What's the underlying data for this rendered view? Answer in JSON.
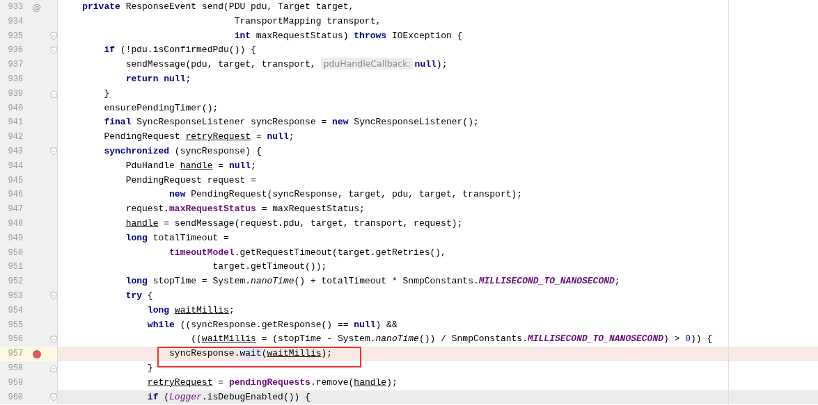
{
  "editor": {
    "lines": [
      {
        "number": "933",
        "gutter_mark": "@",
        "fold_open": false,
        "fold_close": false,
        "breakpoint": false,
        "current": false,
        "tokens": [
          {
            "kind": "keyword",
            "text": "    private"
          },
          {
            "kind": "plain",
            "text": " ResponseEvent send(PDU pdu, Target target,"
          }
        ]
      },
      {
        "number": "934",
        "fold_open": false,
        "fold_close": false,
        "breakpoint": false,
        "current": false,
        "tokens": [
          {
            "kind": "plain",
            "text": "                                TransportMapping transport,"
          }
        ]
      },
      {
        "number": "935",
        "fold_open": true,
        "fold_close": false,
        "breakpoint": false,
        "current": false,
        "tokens": [
          {
            "kind": "keyword",
            "text": "                                int"
          },
          {
            "kind": "plain",
            "text": " maxRequestStatus) "
          },
          {
            "kind": "keyword",
            "text": "throws"
          },
          {
            "kind": "plain",
            "text": " IOException {"
          }
        ]
      },
      {
        "number": "936",
        "fold_open": true,
        "fold_close": false,
        "breakpoint": false,
        "current": false,
        "tokens": [
          {
            "kind": "keyword",
            "text": "        if"
          },
          {
            "kind": "plain",
            "text": " (!pdu.isConfirmedPdu()) {"
          }
        ]
      },
      {
        "number": "937",
        "fold_open": false,
        "fold_close": false,
        "breakpoint": false,
        "current": false,
        "tokens": [
          {
            "kind": "plain",
            "text": "            sendMessage(pdu, target, transport, "
          },
          {
            "kind": "hint",
            "text": "pduHandleCallback:"
          },
          {
            "kind": "keyword",
            "text": "null"
          },
          {
            "kind": "plain",
            "text": ");"
          }
        ]
      },
      {
        "number": "938",
        "fold_open": false,
        "fold_close": false,
        "breakpoint": false,
        "current": false,
        "tokens": [
          {
            "kind": "keyword",
            "text": "            return null"
          },
          {
            "kind": "plain",
            "text": ";"
          }
        ]
      },
      {
        "number": "939",
        "fold_open": false,
        "fold_close": true,
        "breakpoint": false,
        "current": false,
        "tokens": [
          {
            "kind": "plain",
            "text": "        }"
          }
        ]
      },
      {
        "number": "940",
        "fold_open": false,
        "fold_close": false,
        "breakpoint": false,
        "current": false,
        "tokens": [
          {
            "kind": "plain",
            "text": "        ensurePendingTimer();"
          }
        ]
      },
      {
        "number": "941",
        "fold_open": false,
        "fold_close": false,
        "breakpoint": false,
        "current": false,
        "tokens": [
          {
            "kind": "keyword",
            "text": "        final"
          },
          {
            "kind": "plain",
            "text": " SyncResponseListener syncResponse = "
          },
          {
            "kind": "keyword",
            "text": "new"
          },
          {
            "kind": "plain",
            "text": " SyncResponseListener();"
          }
        ]
      },
      {
        "number": "942",
        "fold_open": false,
        "fold_close": false,
        "breakpoint": false,
        "current": false,
        "tokens": [
          {
            "kind": "plain",
            "text": "        PendingRequest "
          },
          {
            "kind": "reassigned",
            "text": "retryRequest"
          },
          {
            "kind": "plain",
            "text": " = "
          },
          {
            "kind": "keyword",
            "text": "null"
          },
          {
            "kind": "plain",
            "text": ";"
          }
        ]
      },
      {
        "number": "943",
        "fold_open": true,
        "fold_close": false,
        "breakpoint": false,
        "current": false,
        "tokens": [
          {
            "kind": "keyword",
            "text": "        synchronized"
          },
          {
            "kind": "plain",
            "text": " (syncResponse) {"
          }
        ]
      },
      {
        "number": "944",
        "fold_open": false,
        "fold_close": false,
        "breakpoint": false,
        "current": false,
        "tokens": [
          {
            "kind": "plain",
            "text": "            PduHandle "
          },
          {
            "kind": "reassigned",
            "text": "handle"
          },
          {
            "kind": "plain",
            "text": " = "
          },
          {
            "kind": "keyword",
            "text": "null"
          },
          {
            "kind": "plain",
            "text": ";"
          }
        ]
      },
      {
        "number": "945",
        "fold_open": false,
        "fold_close": false,
        "breakpoint": false,
        "current": false,
        "tokens": [
          {
            "kind": "plain",
            "text": "            PendingRequest request ="
          }
        ]
      },
      {
        "number": "946",
        "fold_open": false,
        "fold_close": false,
        "breakpoint": false,
        "current": false,
        "tokens": [
          {
            "kind": "keyword",
            "text": "                    new"
          },
          {
            "kind": "plain",
            "text": " PendingRequest(syncResponse, target, pdu, target, transport);"
          }
        ]
      },
      {
        "number": "947",
        "fold_open": false,
        "fold_close": false,
        "breakpoint": false,
        "current": false,
        "tokens": [
          {
            "kind": "plain",
            "text": "            request."
          },
          {
            "kind": "field",
            "text": "maxRequestStatus"
          },
          {
            "kind": "plain",
            "text": " = maxRequestStatus;"
          }
        ]
      },
      {
        "number": "948",
        "fold_open": false,
        "fold_close": false,
        "breakpoint": false,
        "current": false,
        "tokens": [
          {
            "kind": "reassigned",
            "text": "            handle"
          },
          {
            "kind": "plain",
            "text": " = sendMessage(request.pdu, target, transport, request);"
          }
        ]
      },
      {
        "number": "949",
        "fold_open": false,
        "fold_close": false,
        "breakpoint": false,
        "current": false,
        "tokens": [
          {
            "kind": "keyword",
            "text": "            long"
          },
          {
            "kind": "plain",
            "text": " totalTimeout ="
          }
        ]
      },
      {
        "number": "950",
        "fold_open": false,
        "fold_close": false,
        "breakpoint": false,
        "current": false,
        "tokens": [
          {
            "kind": "field",
            "text": "                    timeoutModel"
          },
          {
            "kind": "plain",
            "text": ".getRequestTimeout(target.getRetries(),"
          }
        ]
      },
      {
        "number": "951",
        "fold_open": false,
        "fold_close": false,
        "breakpoint": false,
        "current": false,
        "tokens": [
          {
            "kind": "plain",
            "text": "                            target.getTimeout());"
          }
        ]
      },
      {
        "number": "952",
        "fold_open": false,
        "fold_close": false,
        "breakpoint": false,
        "current": false,
        "tokens": [
          {
            "kind": "keyword",
            "text": "            long"
          },
          {
            "kind": "plain",
            "text": " stopTime = System."
          },
          {
            "kind": "static_method",
            "text": "nanoTime"
          },
          {
            "kind": "plain",
            "text": "() + totalTimeout * SnmpConstants."
          },
          {
            "kind": "constant",
            "text": "MILLISECOND_TO_NANOSECOND"
          },
          {
            "kind": "plain",
            "text": ";"
          }
        ]
      },
      {
        "number": "953",
        "fold_open": true,
        "fold_close": false,
        "breakpoint": false,
        "current": false,
        "tokens": [
          {
            "kind": "keyword",
            "text": "            try"
          },
          {
            "kind": "plain",
            "text": " {"
          }
        ]
      },
      {
        "number": "954",
        "fold_open": false,
        "fold_close": false,
        "breakpoint": false,
        "current": false,
        "tokens": [
          {
            "kind": "keyword",
            "text": "                long"
          },
          {
            "kind": "reassigned",
            "text": " waitMillis"
          },
          {
            "kind": "plain",
            "text": ";"
          }
        ]
      },
      {
        "number": "955",
        "fold_open": false,
        "fold_close": false,
        "breakpoint": false,
        "current": false,
        "tokens": [
          {
            "kind": "keyword",
            "text": "                while"
          },
          {
            "kind": "plain",
            "text": " ((syncResponse.getResponse() == "
          },
          {
            "kind": "keyword",
            "text": "null"
          },
          {
            "kind": "plain",
            "text": ") &&"
          }
        ]
      },
      {
        "number": "956",
        "fold_open": true,
        "fold_close": false,
        "breakpoint": false,
        "current": false,
        "tokens": [
          {
            "kind": "plain",
            "text": "                        (("
          },
          {
            "kind": "reassigned",
            "text": "waitMillis"
          },
          {
            "kind": "plain",
            "text": " = (stopTime - System."
          },
          {
            "kind": "static_method",
            "text": "nanoTime"
          },
          {
            "kind": "plain",
            "text": "()) / SnmpConstants."
          },
          {
            "kind": "constant",
            "text": "MILLISECOND_TO_NANOSECOND"
          },
          {
            "kind": "plain",
            "text": ") > "
          },
          {
            "kind": "number",
            "text": "0"
          },
          {
            "kind": "plain",
            "text": ")) {"
          }
        ]
      },
      {
        "number": "957",
        "fold_open": false,
        "fold_close": false,
        "breakpoint": true,
        "current": false,
        "boxed": true,
        "tokens": [
          {
            "kind": "plain",
            "text": "                    syncResponse."
          },
          {
            "kind": "usage",
            "text": "wait"
          },
          {
            "kind": "plain",
            "text": "("
          },
          {
            "kind": "reassigned",
            "text": "waitMillis"
          },
          {
            "kind": "plain",
            "text": ");"
          }
        ]
      },
      {
        "number": "958",
        "fold_open": false,
        "fold_close": true,
        "breakpoint": false,
        "current": false,
        "tokens": [
          {
            "kind": "plain",
            "text": "                }"
          }
        ]
      },
      {
        "number": "959",
        "fold_open": false,
        "fold_close": false,
        "breakpoint": false,
        "current": false,
        "tokens": [
          {
            "kind": "reassigned",
            "text": "                retryRequest"
          },
          {
            "kind": "plain",
            "text": " = "
          },
          {
            "kind": "field",
            "text": "pendingRequests"
          },
          {
            "kind": "plain",
            "text": ".remove("
          },
          {
            "kind": "reassigned",
            "text": "handle"
          },
          {
            "kind": "plain",
            "text": ");"
          }
        ]
      },
      {
        "number": "960",
        "fold_open": true,
        "fold_close": false,
        "breakpoint": false,
        "current": true,
        "tokens": [
          {
            "kind": "keyword",
            "text": "                if"
          },
          {
            "kind": "plain",
            "text": " ("
          },
          {
            "kind": "static_field",
            "text": "Logger"
          },
          {
            "kind": "plain",
            "text": ".isDebugEnabled()) {"
          }
        ]
      }
    ]
  }
}
